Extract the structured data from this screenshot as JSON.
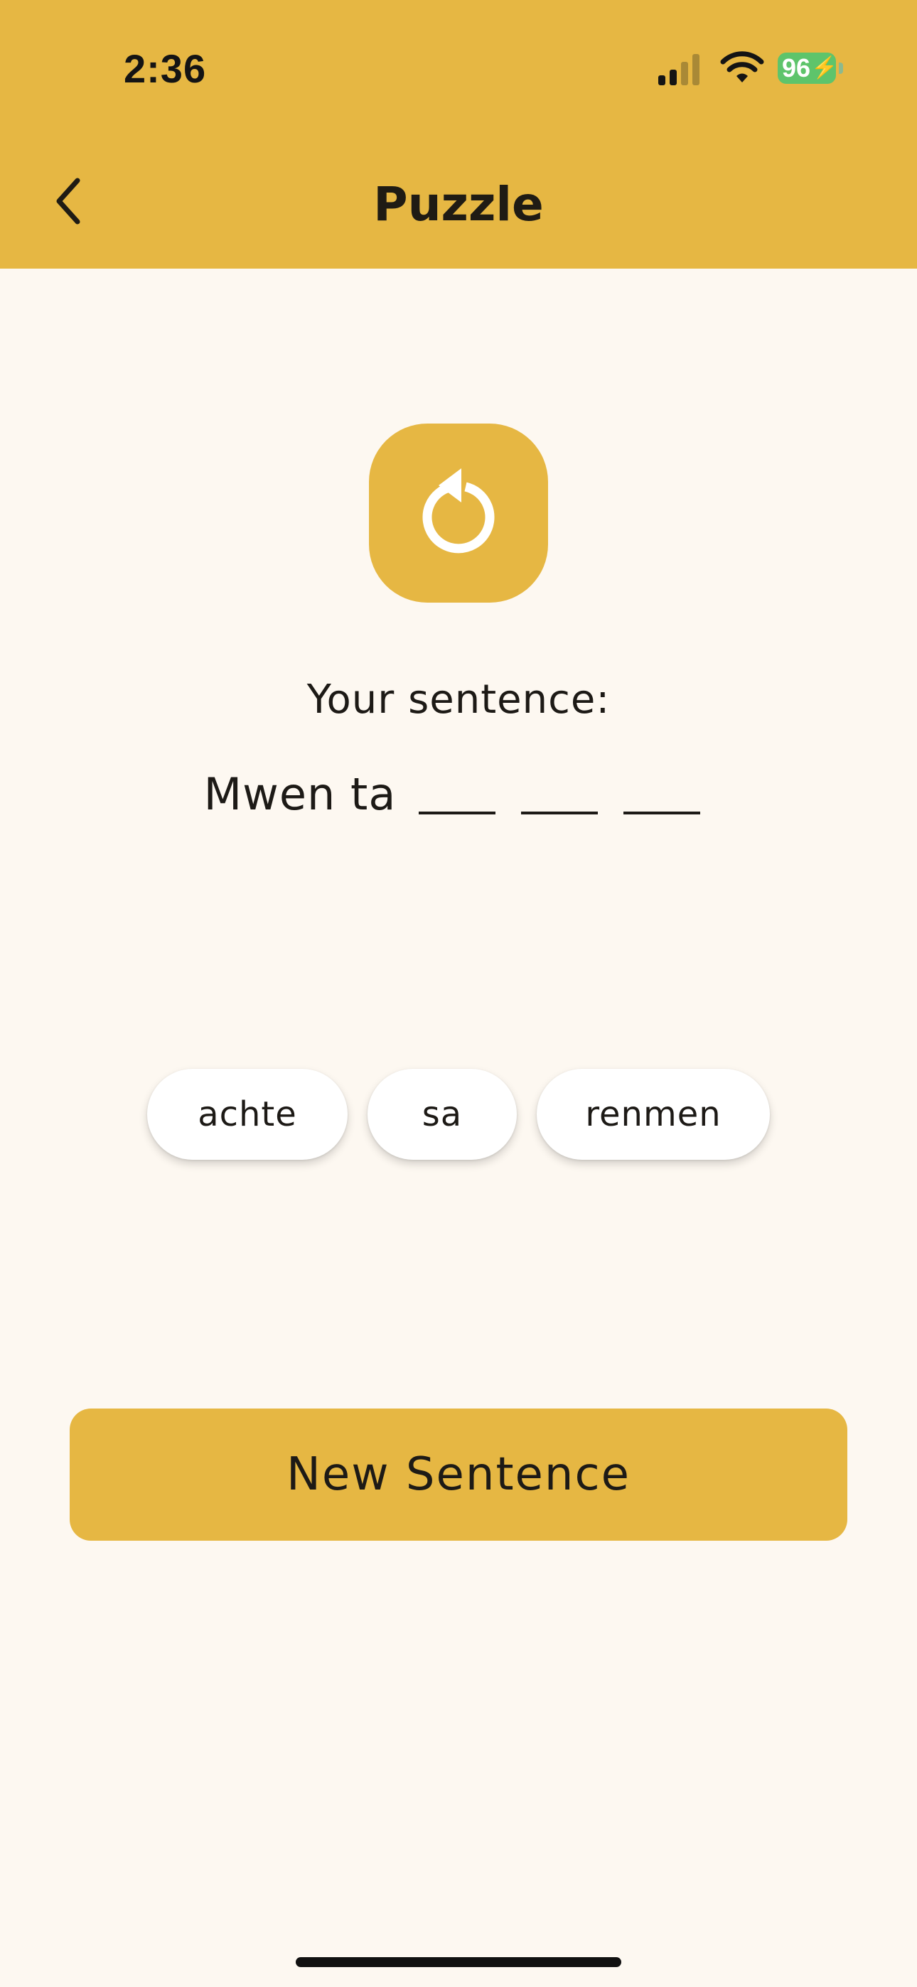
{
  "status_bar": {
    "time": "2:36",
    "battery_percent": "96",
    "battery_charging_glyph": "⚡",
    "signal_icon": "cellular-signal-icon",
    "wifi_icon": "wifi-icon",
    "battery_icon": "battery-charging-icon"
  },
  "header": {
    "title": "Puzzle",
    "back_icon": "chevron-left-icon",
    "background_color": "#E6B743"
  },
  "main": {
    "refresh_icon": "refresh-icon",
    "sentence_label": "Your sentence:",
    "sentence_prefix": "Mwen ta",
    "blanks_count": 3
  },
  "word_chips": [
    {
      "label": "achte"
    },
    {
      "label": "sa"
    },
    {
      "label": "renmen"
    }
  ],
  "actions": {
    "new_sentence_label": "New Sentence"
  },
  "colors": {
    "accent": "#E6B743",
    "background": "#FDF8F1",
    "text": "#1D1A16",
    "battery": "#5EC46B"
  }
}
